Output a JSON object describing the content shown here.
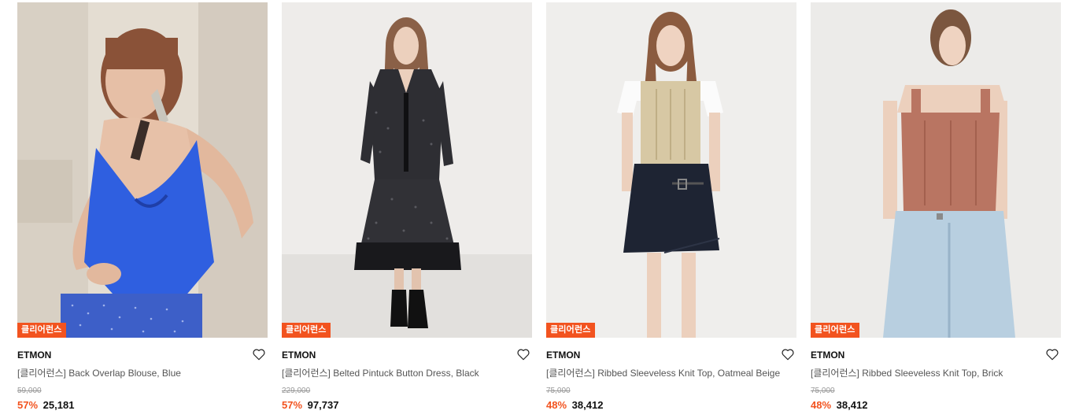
{
  "products": [
    {
      "badge": "클리어런스",
      "brand": "ETMON",
      "name": "[클리어런스] Back Overlap Blouse, Blue",
      "original_price": "59,000",
      "discount": "57%",
      "price": "25,181",
      "colors": {
        "bg": "#e6e0d6",
        "main": "#2f5fe0",
        "accent": "#4a3a33"
      }
    },
    {
      "badge": "클리어런스",
      "brand": "ETMON",
      "name": "[클리어런스] Belted Pintuck Button Dress, Black",
      "original_price": "229,000",
      "discount": "57%",
      "price": "97,737",
      "colors": {
        "bg": "#efedeb",
        "main": "#2a2a2e",
        "accent": "#7a5a44"
      }
    },
    {
      "badge": "클리어런스",
      "brand": "ETMON",
      "name": "[클리어런스] Ribbed Sleeveless Knit Top, Oatmeal Beige",
      "original_price": "75,000",
      "discount": "48%",
      "price": "38,412",
      "colors": {
        "bg": "#efeeec",
        "main": "#d7c8a4",
        "accent": "#1e2433"
      }
    },
    {
      "badge": "클리어런스",
      "brand": "ETMON",
      "name": "[클리어런스] Ribbed Sleeveless Knit Top, Brick",
      "original_price": "75,000",
      "discount": "48%",
      "price": "38,412",
      "colors": {
        "bg": "#ecebe9",
        "main": "#b97562",
        "accent": "#b8cfe0"
      }
    }
  ],
  "icons": {
    "wishlist": "heart-outline-icon"
  },
  "accent_color": "#f2531f"
}
